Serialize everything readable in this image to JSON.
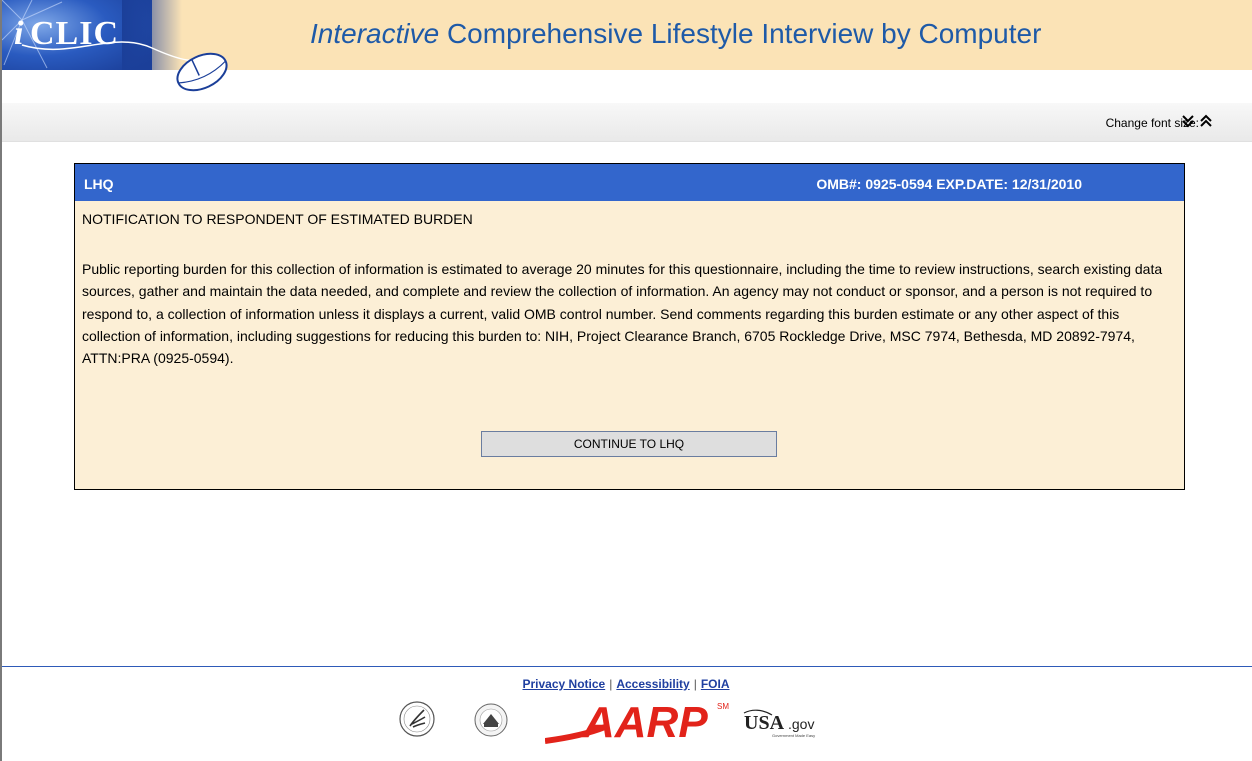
{
  "header": {
    "logo_text": "iCLIC",
    "title_italic": "Interactive",
    "title_rest": " Comprehensive Lifestyle Interview by Computer"
  },
  "toolbar": {
    "font_size_label": "Change font size:",
    "decrease_icon": "double-chevron-down-icon",
    "increase_icon": "double-chevron-up-icon"
  },
  "notice": {
    "header_left": "LHQ",
    "header_right": "OMB#: 0925-0594 EXP.DATE: 12/31/2010",
    "heading": "NOTIFICATION TO RESPONDENT OF ESTIMATED BURDEN",
    "body": "Public reporting burden for this collection of information is estimated to average 20 minutes for this questionnaire, including the time to review instructions, search existing data sources, gather and maintain the data needed, and complete and review the collection of information. An agency may not conduct or sponsor, and a person is not required to respond to, a collection of information unless it displays a current, valid OMB control number. Send comments regarding this burden estimate or any other aspect of this collection of information, including suggestions for reducing this burden to: NIH, Project Clearance Branch, 6705 Rockledge Drive, MSC 7974, Bethesda, MD 20892-7974, ATTN:PRA (0925-0594).",
    "continue_label": "CONTINUE TO LHQ"
  },
  "footer": {
    "links": [
      "Privacy Notice",
      "Accessibility",
      "FOIA"
    ],
    "separator": "|",
    "logos": {
      "aarp": "AARP",
      "aarp_mark": "SM",
      "usagov": "USA.gov",
      "usagov_tagline": "Government Made Easy"
    }
  },
  "colors": {
    "header_band": "#fbe3b6",
    "title_blue": "#1e5aa8",
    "notice_header": "#3366cc",
    "notice_bg": "#fcefd6",
    "aarp_red": "#e2231a"
  }
}
